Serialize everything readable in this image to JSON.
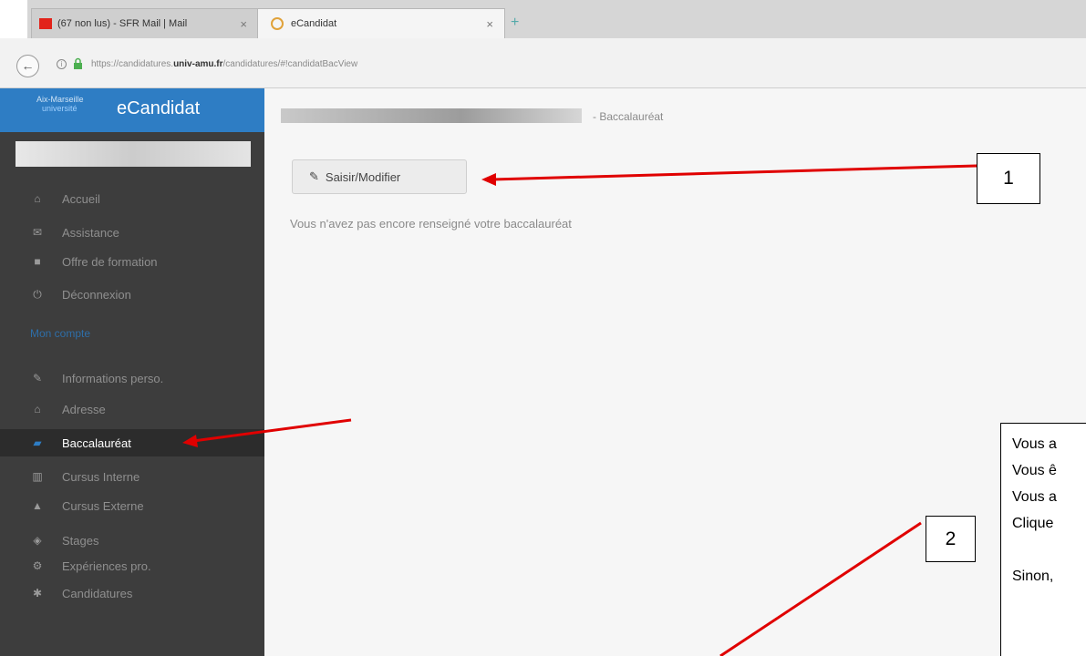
{
  "browser": {
    "tabs": [
      {
        "title": "(67 non lus) - SFR Mail | Mail"
      },
      {
        "title": "eCandidat"
      }
    ],
    "url_prefix": "https://candidatures.",
    "url_domain": "univ-amu.fr",
    "url_suffix": "/candidatures/#!candidatBacView"
  },
  "sidebar": {
    "logo_line1": "Aix-Marseille",
    "logo_line2": "université",
    "app_title": "eCandidat",
    "items_top": [
      {
        "label": "Accueil",
        "icon": "home-icon"
      },
      {
        "label": "Assistance",
        "icon": "support-icon"
      },
      {
        "label": "Offre de formation",
        "icon": "bookmark-icon"
      },
      {
        "label": "Déconnexion",
        "icon": "power-icon"
      }
    ],
    "section_label": "Mon compte",
    "items_account": [
      {
        "label": "Informations perso.",
        "icon": "pencil-icon"
      },
      {
        "label": "Adresse",
        "icon": "home-icon"
      },
      {
        "label": "Baccalauréat",
        "icon": "bac-icon",
        "active": true
      },
      {
        "label": "Cursus Interne",
        "icon": "institution-icon"
      },
      {
        "label": "Cursus Externe",
        "icon": "graduation-cap-icon"
      },
      {
        "label": "Stages",
        "icon": "briefcase-icon"
      },
      {
        "label": "Expériences pro.",
        "icon": "gears-icon"
      },
      {
        "label": "Candidatures",
        "icon": "star-icon"
      }
    ]
  },
  "main": {
    "breadcrumb_suffix": "- Baccalauréat",
    "edit_button": "Saisir/Modifier",
    "info_message": "Vous n'avez pas encore renseigné votre baccalauréat"
  },
  "annotations": {
    "box1": "1",
    "box2": "2",
    "callout_lines": [
      "Vous a",
      "Vous ê",
      "Vous a",
      "Clique",
      "",
      "Sinon,"
    ]
  },
  "colors": {
    "accent": "#2e7dc4",
    "sidebar_bg": "#3d3d3d",
    "arrow": "#e00000"
  }
}
